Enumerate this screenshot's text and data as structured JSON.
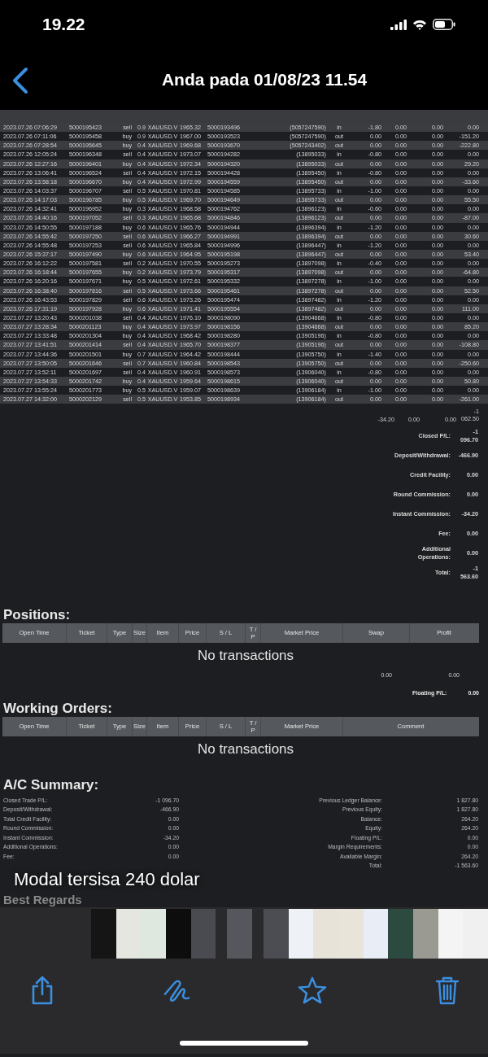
{
  "status_bar": {
    "time": "19.22"
  },
  "nav_bar": {
    "title": "Anda pada 01/08/23 11.54"
  },
  "deals": {
    "rows": [
      {
        "cells": [
          "2023.07.26 07:06:29",
          "5000195423",
          "sell",
          "0.9",
          "XAUUSD.V",
          "1965.32",
          "5000193496",
          "(5057247590)",
          "in",
          "-1.80",
          "0.00",
          "0.00",
          "0.00"
        ]
      },
      {
        "cells": [
          "2023.07.26 07:11:06",
          "5000195458",
          "buy",
          "0.9",
          "XAUUSD.V",
          "1967.00",
          "5000193523",
          "(5057247590)",
          "out",
          "0.00",
          "0.00",
          "0.00",
          "-151.20"
        ]
      },
      {
        "cells": [
          "2023.07.26 07:28:54",
          "5000195645",
          "buy",
          "0.4",
          "XAUUSD.V",
          "1969.68",
          "5000193670",
          "(5057243402)",
          "out",
          "0.00",
          "0.00",
          "0.00",
          "-222.80"
        ]
      },
      {
        "cells": [
          "2023.07.26 12:05:24",
          "5000196348",
          "sell",
          "0.4",
          "XAUUSD.V",
          "1973.07",
          "5000194282",
          "(13895033)",
          "in",
          "-0.80",
          "0.00",
          "0.00",
          "0.00"
        ]
      },
      {
        "cells": [
          "2023.07.26 12:27:16",
          "5000196401",
          "buy",
          "0.4",
          "XAUUSD.V",
          "1972.34",
          "5000194320",
          "(13895033)",
          "out",
          "0.00",
          "0.00",
          "0.00",
          "29.20"
        ]
      },
      {
        "cells": [
          "2023.07.26 13:06:41",
          "5000196524",
          "sell",
          "0.4",
          "XAUUSD.V",
          "1972.15",
          "5000194428",
          "(13895450)",
          "in",
          "-0.80",
          "0.00",
          "0.00",
          "0.00"
        ]
      },
      {
        "cells": [
          "2023.07.26 13:58:18",
          "5000196670",
          "buy",
          "0.4",
          "XAUUSD.V",
          "1972.99",
          "5000194559",
          "(13895450)",
          "out",
          "0.00",
          "0.00",
          "0.00",
          "-33.60"
        ]
      },
      {
        "cells": [
          "2023.07.26 14:03:37",
          "5000196707",
          "sell",
          "0.5",
          "XAUUSD.V",
          "1970.81",
          "5000194585",
          "(13895733)",
          "in",
          "-1.00",
          "0.00",
          "0.00",
          "0.00"
        ]
      },
      {
        "cells": [
          "2023.07.26 14:17:03",
          "5000196785",
          "buy",
          "0.5",
          "XAUUSD.V",
          "1969.70",
          "5000194649",
          "(13895733)",
          "out",
          "0.00",
          "0.00",
          "0.00",
          "55.50"
        ]
      },
      {
        "cells": [
          "2023.07.26 14:32:41",
          "5000196952",
          "buy",
          "0.3",
          "XAUUSD.V",
          "1968.58",
          "5000194762",
          "(13896123)",
          "in",
          "-0.60",
          "0.00",
          "0.00",
          "0.00"
        ]
      },
      {
        "cells": [
          "2023.07.26 14:40:16",
          "5000197052",
          "sell",
          "0.3",
          "XAUUSD.V",
          "1965.68",
          "5000194846",
          "(13896123)",
          "out",
          "0.00",
          "0.00",
          "0.00",
          "-87.00"
        ]
      },
      {
        "cells": [
          "2023.07.26 14:50:55",
          "5000197188",
          "buy",
          "0.6",
          "XAUUSD.V",
          "1965.76",
          "5000194944",
          "(13896394)",
          "in",
          "-1.20",
          "0.00",
          "0.00",
          "0.00"
        ]
      },
      {
        "cells": [
          "2023.07.26 14:55:42",
          "5000197250",
          "sell",
          "0.6",
          "XAUUSD.V",
          "1966.27",
          "5000194991",
          "(13896394)",
          "out",
          "0.00",
          "0.00",
          "0.00",
          "30.60"
        ]
      },
      {
        "cells": [
          "2023.07.26 14:55:48",
          "5000197253",
          "sell",
          "0.6",
          "XAUUSD.V",
          "1965.84",
          "5000194996",
          "(13896447)",
          "in",
          "-1.20",
          "0.00",
          "0.00",
          "0.00"
        ]
      },
      {
        "cells": [
          "2023.07.26 15:37:17",
          "5000197490",
          "buy",
          "0.6",
          "XAUUSD.V",
          "1964.95",
          "5000195198",
          "(13896447)",
          "out",
          "0.00",
          "0.00",
          "0.00",
          "53.40"
        ]
      },
      {
        "cells": [
          "2023.07.26 16:12:22",
          "5000197581",
          "sell",
          "0.2",
          "XAUUSD.V",
          "1970.55",
          "5000195273",
          "(13897098)",
          "in",
          "-0.40",
          "0.00",
          "0.00",
          "0.00"
        ]
      },
      {
        "cells": [
          "2023.07.26 16:18:44",
          "5000197655",
          "buy",
          "0.2",
          "XAUUSD.V",
          "1973.79",
          "5000195317",
          "(13897098)",
          "out",
          "0.00",
          "0.00",
          "0.00",
          "-64.80"
        ]
      },
      {
        "cells": [
          "2023.07.26 16:20:16",
          "5000197671",
          "buy",
          "0.5",
          "XAUUSD.V",
          "1972.61",
          "5000195332",
          "(13897278)",
          "in",
          "-1.00",
          "0.00",
          "0.00",
          "0.00"
        ]
      },
      {
        "cells": [
          "2023.07.26 16:38:40",
          "5000197816",
          "sell",
          "0.5",
          "XAUUSD.V",
          "1973.66",
          "5000195461",
          "(13897278)",
          "out",
          "0.00",
          "0.00",
          "0.00",
          "52.50"
        ]
      },
      {
        "cells": [
          "2023.07.26 16:43:53",
          "5000197829",
          "sell",
          "0.6",
          "XAUUSD.V",
          "1973.26",
          "5000195474",
          "(13897482)",
          "in",
          "-1.20",
          "0.00",
          "0.00",
          "0.00"
        ]
      },
      {
        "cells": [
          "2023.07.26 17:31:19",
          "5000197928",
          "buy",
          "0.6",
          "XAUUSD.V",
          "1971.41",
          "5000195554",
          "(13897482)",
          "out",
          "0.00",
          "0.00",
          "0.00",
          "111.00"
        ]
      },
      {
        "cells": [
          "2023.07.27 13:20:43",
          "5000201038",
          "sell",
          "0.4",
          "XAUUSD.V",
          "1976.10",
          "5000198090",
          "(13904668)",
          "in",
          "-0.80",
          "0.00",
          "0.00",
          "0.00"
        ]
      },
      {
        "cells": [
          "2023.07.27 13:28:34",
          "5000201123",
          "buy",
          "0.4",
          "XAUUSD.V",
          "1973.97",
          "5000198156",
          "(13904668)",
          "out",
          "0.00",
          "0.00",
          "0.00",
          "85.20"
        ]
      },
      {
        "cells": [
          "2023.07.27 13:33:48",
          "5000201304",
          "buy",
          "0.4",
          "XAUUSD.V",
          "1968.42",
          "5000198280",
          "(13905196)",
          "in",
          "-0.80",
          "0.00",
          "0.00",
          "0.00"
        ]
      },
      {
        "cells": [
          "2023.07.27 13:41:51",
          "5000201414",
          "sell",
          "0.4",
          "XAUUSD.V",
          "1965.70",
          "5000198377",
          "(13905196)",
          "out",
          "0.00",
          "0.00",
          "0.00",
          "-108.80"
        ]
      },
      {
        "cells": [
          "2023.07.27 13:44:36",
          "5000201501",
          "buy",
          "0.7",
          "XAUUSD.V",
          "1964.42",
          "5000198444",
          "(13905750)",
          "in",
          "-1.40",
          "0.00",
          "0.00",
          "0.00"
        ]
      },
      {
        "cells": [
          "2023.07.27 13:50:05",
          "5000201646",
          "sell",
          "0.7",
          "XAUUSD.V",
          "1960.84",
          "5000198543",
          "(13905750)",
          "out",
          "0.00",
          "0.00",
          "0.00",
          "-250.60"
        ]
      },
      {
        "cells": [
          "2023.07.27 13:52:11",
          "5000201697",
          "sell",
          "0.4",
          "XAUUSD.V",
          "1960.91",
          "5000198573",
          "(13906040)",
          "in",
          "-0.80",
          "0.00",
          "0.00",
          "0.00"
        ]
      },
      {
        "cells": [
          "2023.07.27 13:54:33",
          "5000201742",
          "buy",
          "0.4",
          "XAUUSD.V",
          "1959.64",
          "5000198615",
          "(13906040)",
          "out",
          "0.00",
          "0.00",
          "0.00",
          "50.80"
        ]
      },
      {
        "cells": [
          "2023.07.27 13:55:24",
          "5000201773",
          "buy",
          "0.5",
          "XAUUSD.V",
          "1959.07",
          "5000198639",
          "(13906184)",
          "in",
          "-1.00",
          "0.00",
          "0.00",
          "0.00"
        ]
      },
      {
        "cells": [
          "2023.07.27 14:32:00",
          "5000202129",
          "sell",
          "0.5",
          "XAUUSD.V",
          "1953.85",
          "5000198934",
          "(13906184)",
          "out",
          "0.00",
          "0.00",
          "0.00",
          "-261.00"
        ]
      }
    ],
    "totals": [
      "-34.20",
      "0.00",
      "0.00",
      "-1 062.50"
    ]
  },
  "summary": [
    {
      "label": "Closed P/L:",
      "value": "-1 096.70"
    },
    {
      "label": "Deposit/Withdrawal:",
      "value": "-466.90"
    },
    {
      "label": "Credit Facility:",
      "value": "0.00"
    },
    {
      "label": "Round Commission:",
      "value": "0.00"
    },
    {
      "label": "Instant Commission:",
      "value": "-34.20"
    },
    {
      "label": "Fee:",
      "value": "0.00"
    },
    {
      "label": "Additional Operations:",
      "value": "0.00"
    },
    {
      "label": "Total:",
      "value": "-1 563.60"
    }
  ],
  "positions": {
    "title": "Positions:",
    "columns": [
      "Open Time",
      "Ticket",
      "Type",
      "Size",
      "Item",
      "Price",
      "S / L",
      "T / P",
      "Market Price",
      "Swap",
      "Profit"
    ],
    "empty_message": "No transactions",
    "totals": [
      "0.00",
      "0.00"
    ],
    "floating_label": "Floating P/L:",
    "floating_value": "0.00"
  },
  "working_orders": {
    "title": "Working Orders:",
    "columns": [
      "Open Time",
      "Ticket",
      "Type",
      "Size",
      "Item",
      "Price",
      "S / L",
      "T / P",
      "Market Price",
      "Comment"
    ],
    "empty_message": "No transactions"
  },
  "ac_summary": {
    "title": "A/C Summary:",
    "left": [
      {
        "label": "Closed Trade P/L:",
        "value": "-1 096.70"
      },
      {
        "label": "Deposit/Withdrawal:",
        "value": "-466.90"
      },
      {
        "label": "Total Credit Facility:",
        "value": "0.00"
      },
      {
        "label": "Round Commission:",
        "value": "0.00"
      },
      {
        "label": "Instant Commission:",
        "value": "-34.20"
      },
      {
        "label": "Additional Operations:",
        "value": "0.00"
      },
      {
        "label": "Fee:",
        "value": "0.00"
      }
    ],
    "right": [
      {
        "label": "Previous Ledger Balance:",
        "value": "1 827.80"
      },
      {
        "label": "Previous Equity:",
        "value": "1 827.80"
      },
      {
        "label": "Balance:",
        "value": "264.20"
      },
      {
        "label": "Equity:",
        "value": "264.20"
      },
      {
        "label": "Floating P/L:",
        "value": "0.00"
      },
      {
        "label": "Margin Requirements:",
        "value": "0.00"
      },
      {
        "label": "Available Margin:",
        "value": "264.20"
      },
      {
        "label": "Total:",
        "value": "-1 563.60"
      }
    ]
  },
  "email_footer": "Best Regards",
  "caption": "Modal tersisa 240 dolar"
}
